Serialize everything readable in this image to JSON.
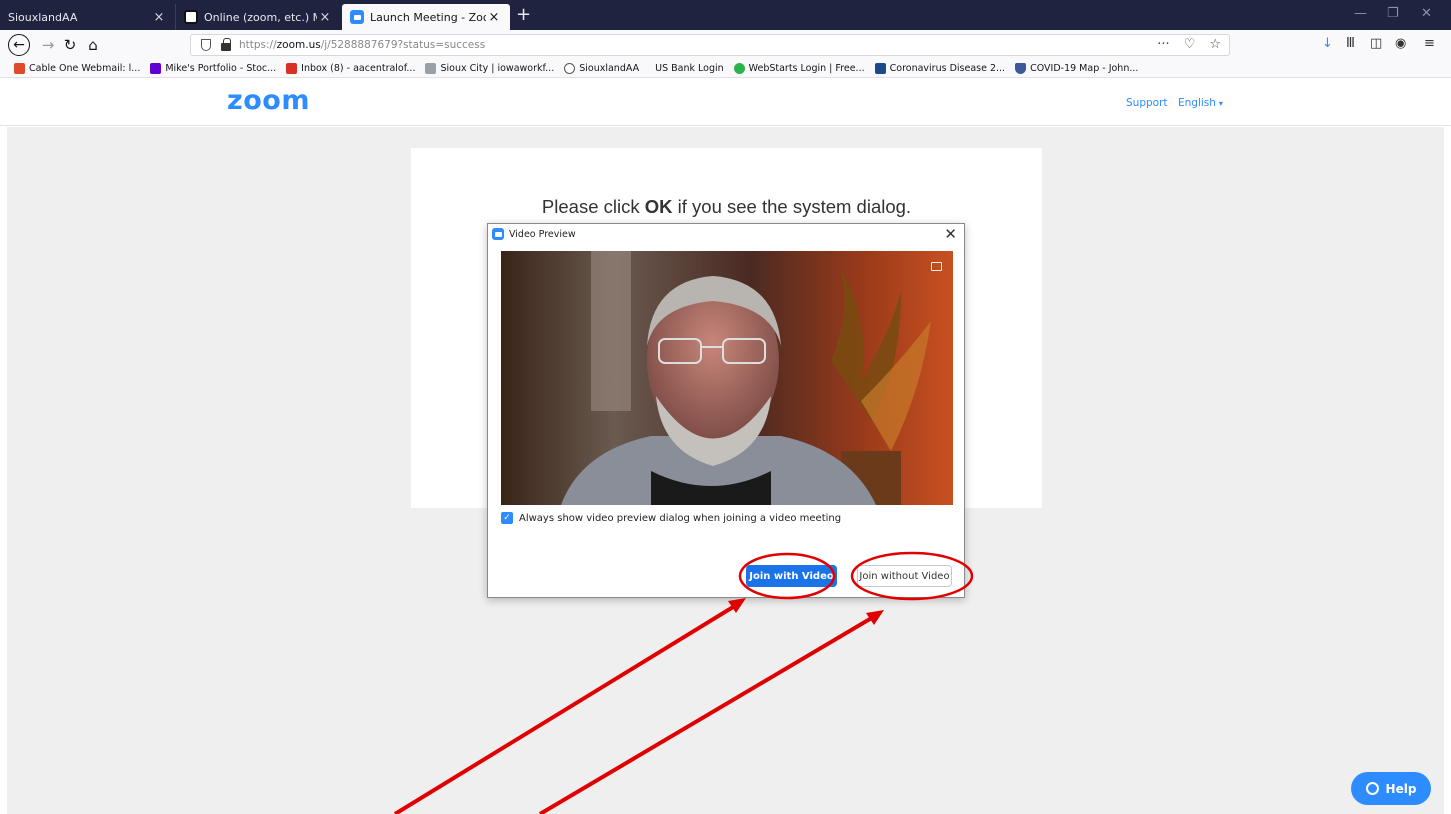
{
  "browser": {
    "tabs": [
      {
        "title": "SiouxlandAA",
        "close": "×"
      },
      {
        "title": "Online (zoom, etc.) Meeting Se",
        "close": "×"
      },
      {
        "title": "Launch Meeting - Zoom",
        "close": "×"
      }
    ],
    "new_tab": "+",
    "window_controls": {
      "minimize": "—",
      "restore": "❐",
      "close": "✕"
    },
    "nav": {
      "back": "←",
      "forward": "→",
      "reload": "↻",
      "home": "⌂"
    },
    "url": {
      "prefix": "https://",
      "domain": "zoom.us",
      "path": "/j/5288887679?status=success"
    },
    "url_actions": {
      "more": "···",
      "pocket": "♡",
      "bookmark": "☆"
    },
    "toolbar_icons": {
      "download": "↓",
      "library": "Ⅲ",
      "sidebar": "◫",
      "account": "◉",
      "menu": "≡"
    },
    "bookmarks": [
      {
        "label": "Cable One Webmail: l...",
        "color": "#e04a2a"
      },
      {
        "label": "Mike's Portfolio - Stoc...",
        "color": "#6001d2"
      },
      {
        "label": "Inbox (8) - aacentralof...",
        "color": "#d93025"
      },
      {
        "label": "Sioux City | iowaworkf...",
        "color": "#9aa0a6"
      },
      {
        "label": "SiouxlandAA",
        "color": "#555555"
      },
      {
        "label": "US Bank Login",
        "color": "#ffffff"
      },
      {
        "label": "WebStarts Login | Free...",
        "color": "#2bb24c"
      },
      {
        "label": "Coronavirus Disease 2...",
        "color": "#1a4a8a"
      },
      {
        "label": "COVID-19 Map - John...",
        "color": "#3a5a9a"
      }
    ]
  },
  "zoom": {
    "logo": "zoom",
    "support": "Support",
    "language": "English",
    "message_before": "Please click ",
    "message_bold": "OK",
    "message_after": " if you see the system dialog."
  },
  "dialog": {
    "title": "Video Preview",
    "close": "✕",
    "checkbox_label": "Always show video preview dialog when joining a video meeting",
    "checkbox_checked": true,
    "join_with_video": "Join with Video",
    "join_without_video": "Join without Video"
  },
  "help": {
    "label": "Help"
  },
  "colors": {
    "accent": "#2d8cff",
    "annotation": "#e00000"
  }
}
